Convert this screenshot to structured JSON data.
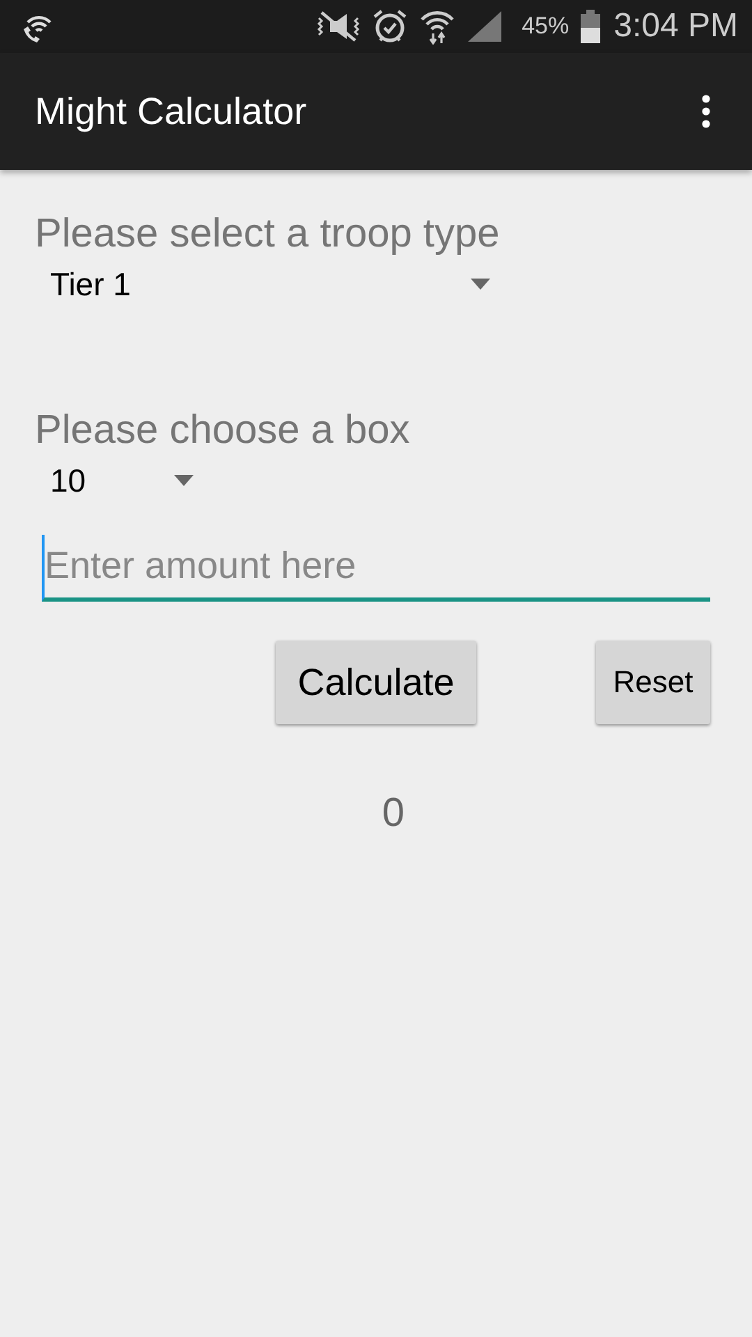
{
  "status_bar": {
    "battery": "45%",
    "time": "3:04 PM"
  },
  "toolbar": {
    "title": "Might Calculator"
  },
  "troop_section": {
    "label": "Please select a troop type",
    "spinner_value": "Tier 1"
  },
  "box_section": {
    "label": "Please choose a box",
    "spinner_value": "10"
  },
  "amount_field": {
    "placeholder": "Enter amount here"
  },
  "buttons": [
    {
      "label": "Calculate",
      "kind": "large"
    },
    {
      "label": "Reset",
      "kind": "small"
    }
  ],
  "result": "0"
}
